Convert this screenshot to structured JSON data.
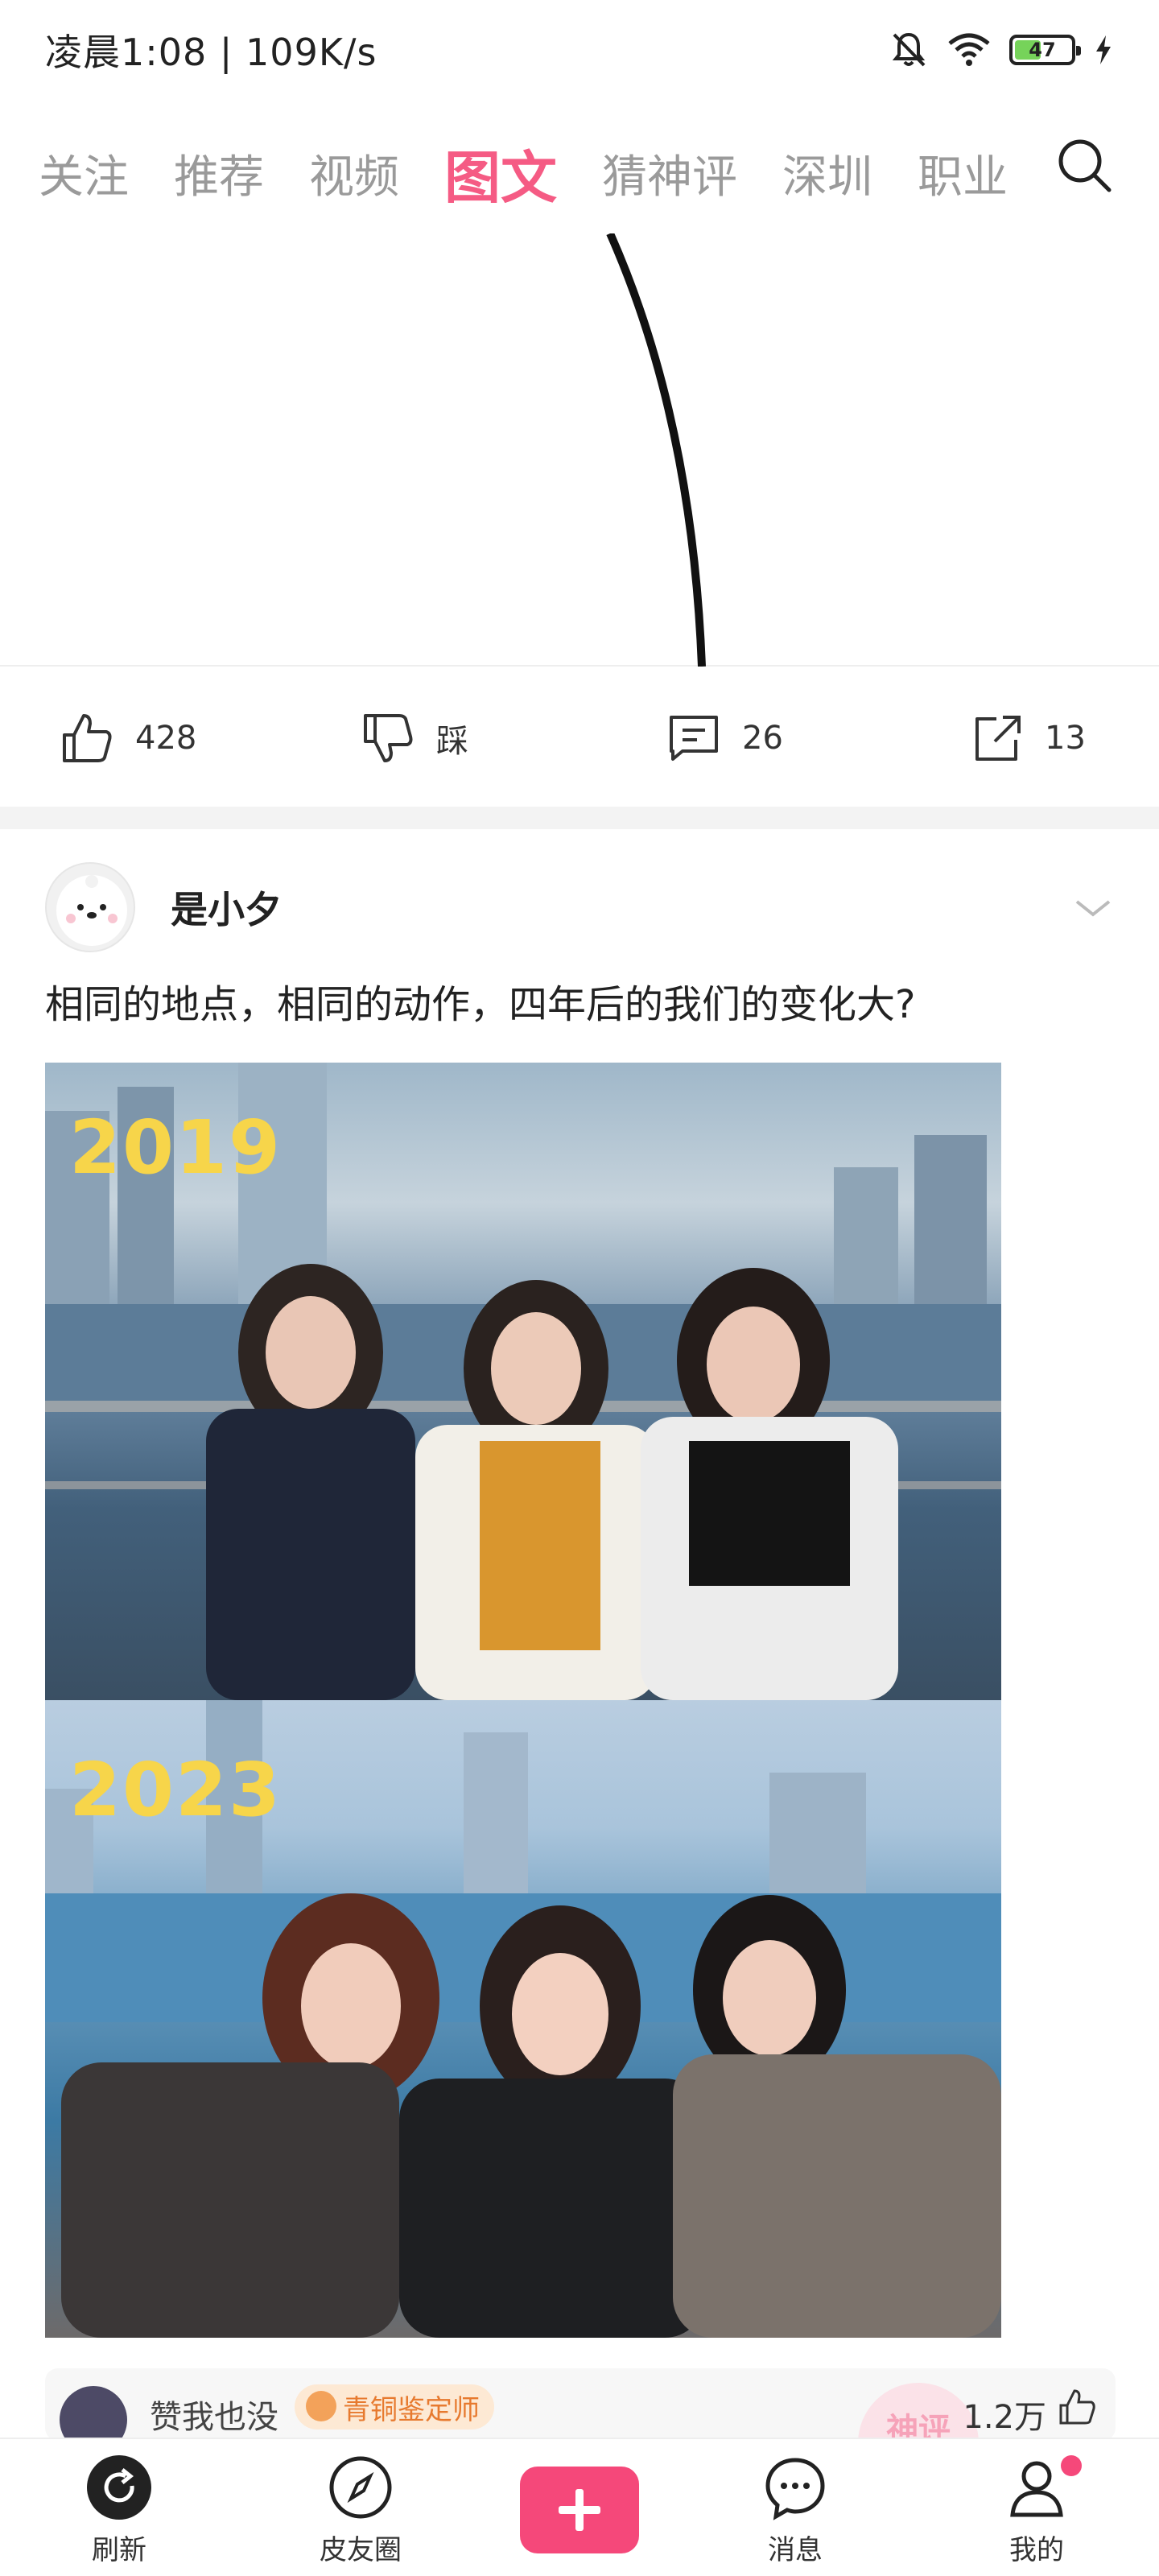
{
  "status_bar": {
    "time_speed": "凌晨1:08 | 109K/s",
    "battery": "47",
    "battery_level": 0.47
  },
  "tabs": [
    {
      "label": "关注",
      "active": false
    },
    {
      "label": "推荐",
      "active": false
    },
    {
      "label": "视频",
      "active": false
    },
    {
      "label": "图文",
      "active": true
    },
    {
      "label": "猜神评",
      "active": false
    },
    {
      "label": "深圳",
      "active": false
    },
    {
      "label": "职业",
      "active": false
    }
  ],
  "first_post": {
    "actions": {
      "like_count": "428",
      "dislike_label": "踩",
      "comment_count": "26",
      "share_count": "13"
    }
  },
  "second_post": {
    "author": "是小夕",
    "text": "相同的地点，相同的动作，四年后的我们的变化大?",
    "photo": {
      "top_year": "2019",
      "bottom_year": "2023"
    },
    "top_comment": {
      "author": "赞我也没",
      "badge": "青铜鉴定师",
      "stamp": "神评",
      "likes": "1.2万"
    }
  },
  "bottom_nav": [
    {
      "label": "刷新",
      "icon": "refresh-icon"
    },
    {
      "label": "皮友圈",
      "icon": "compass-icon"
    },
    {
      "label": "",
      "icon": "plus-icon"
    },
    {
      "label": "消息",
      "icon": "chat-bubble-icon"
    },
    {
      "label": "我的",
      "icon": "person-icon"
    }
  ],
  "colors": {
    "accent": "#f5487a",
    "active_tab": "#f55b84",
    "year_label": "#f7d54a"
  }
}
